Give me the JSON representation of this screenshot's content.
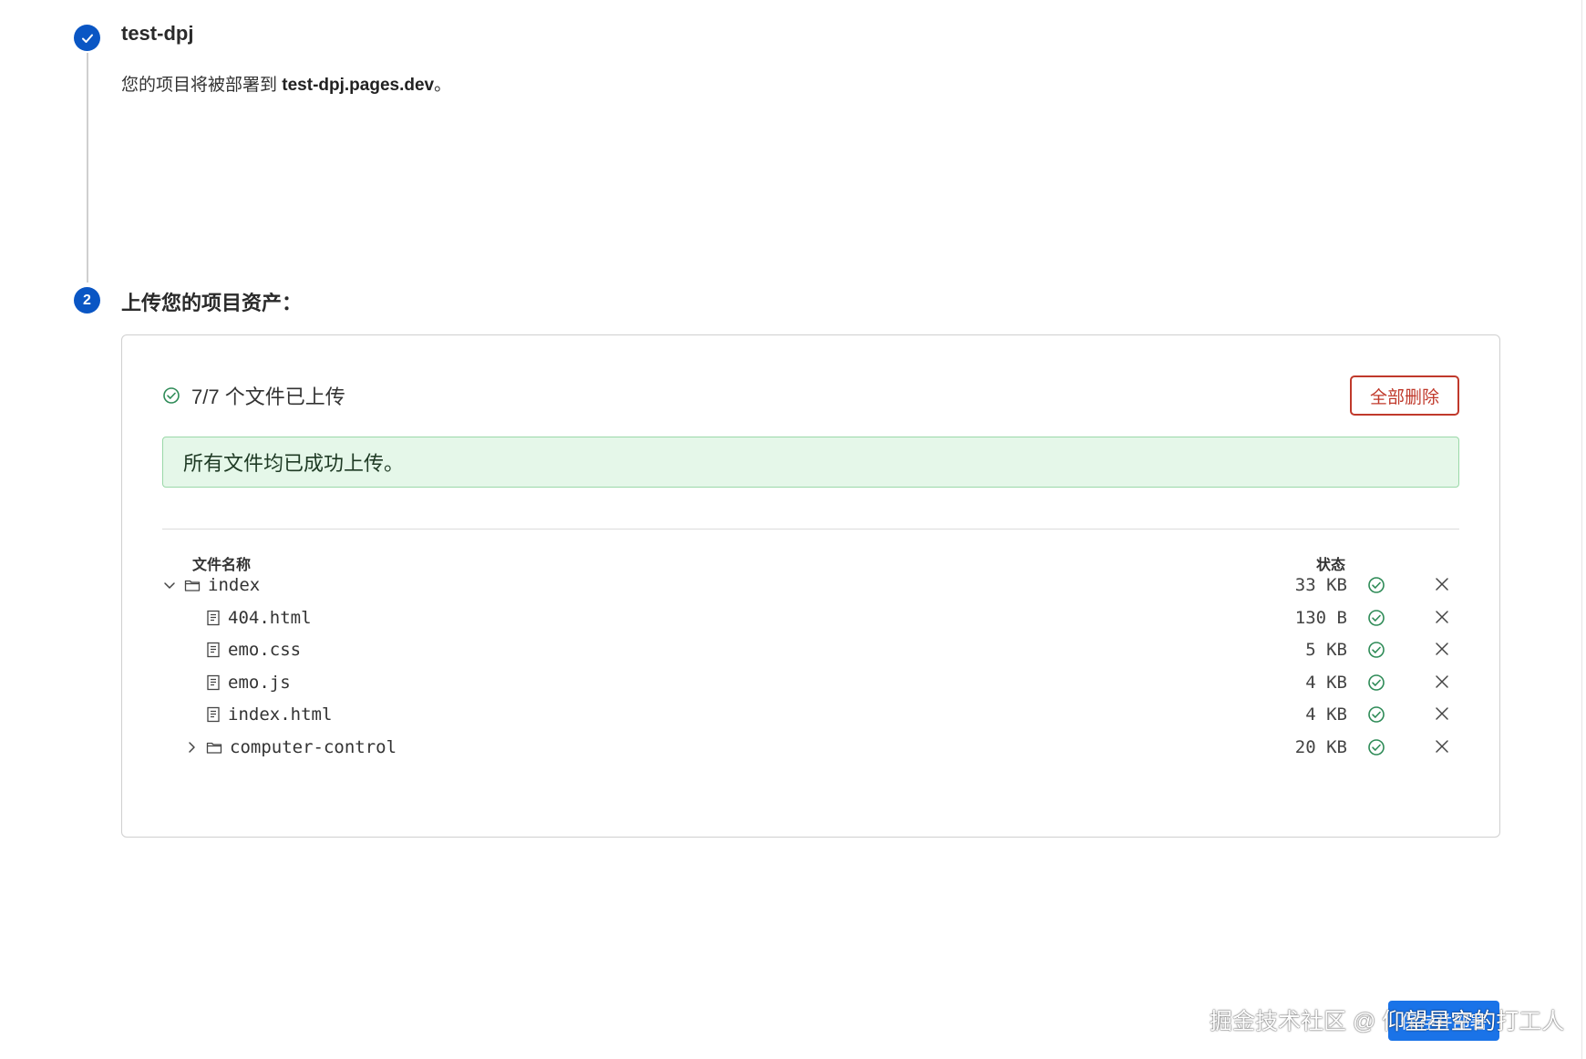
{
  "steps": {
    "step1": {
      "title": "test-dpj",
      "desc_prefix": "您的项目将被部署到 ",
      "desc_domain": "test-dpj.pages.dev",
      "desc_suffix": "。"
    },
    "step2": {
      "number": "2",
      "title": "上传您的项目资产："
    }
  },
  "upload": {
    "summary": "7/7 个文件已上传",
    "delete_all_label": "全部删除",
    "success_message": "所有文件均已成功上传。",
    "columns": {
      "name": "文件名称",
      "status": "状态"
    },
    "files": [
      {
        "name": "index",
        "type": "folder",
        "expanded": true,
        "level": 0,
        "size": "33 KB"
      },
      {
        "name": "404.html",
        "type": "file",
        "level": 1,
        "size": "130 B"
      },
      {
        "name": "emo.css",
        "type": "file",
        "level": 1,
        "size": "5 KB"
      },
      {
        "name": "emo.js",
        "type": "file",
        "level": 1,
        "size": "4 KB"
      },
      {
        "name": "index.html",
        "type": "file",
        "level": 1,
        "size": "4 KB"
      },
      {
        "name": "computer-control",
        "type": "folder",
        "expanded": false,
        "level": 1,
        "size": "20 KB"
      }
    ]
  },
  "footer": {
    "button_label": "保存并部署",
    "watermark": "掘金技术社区 @ 仰望星空的打工人"
  },
  "colors": {
    "primary": "#0a56c4",
    "danger": "#c0392b",
    "success": "#2e8b57",
    "banner_bg": "#e5f7e9"
  }
}
